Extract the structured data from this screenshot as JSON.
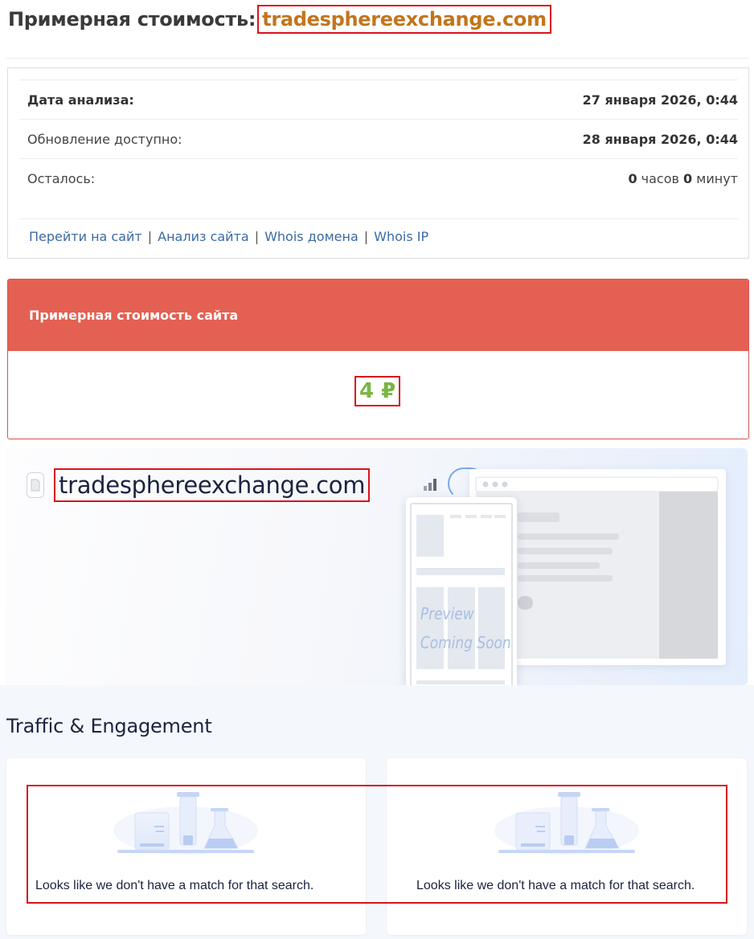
{
  "heading": {
    "prefix": "Примерная стоимость:",
    "domain": "tradesphereexchange.com"
  },
  "info": {
    "rows": [
      {
        "label": "Дата анализа:",
        "value": "27 января 2026, 0:44"
      },
      {
        "label": "Обновление доступно:",
        "value": "28 января 2026, 0:44"
      },
      {
        "label": "Осталось:",
        "hours": "0",
        "hours_unit": "часов",
        "minutes": "0",
        "minutes_unit": "минут"
      }
    ],
    "links": [
      "Перейти на сайт",
      "Анализ сайта",
      "Whois домена",
      "Whois IP"
    ],
    "separator": "|"
  },
  "price_card": {
    "title": "Примерная стоимость сайта",
    "value": "4 ₽",
    "value_color": "#79b642",
    "header_color": "#e46052"
  },
  "preview": {
    "domain": "tradesphereexchange.com",
    "placeholder_line1": "Preview",
    "placeholder_line2": "Coming Soon"
  },
  "traffic": {
    "title": "Traffic & Engagement",
    "cards": [
      {
        "message": "Looks like we don't have a match for that search."
      },
      {
        "message": "Looks like we don't have a match for that search."
      }
    ]
  },
  "colors": {
    "accent_red": "#d9131b",
    "domain_orange": "#c2751b",
    "link_blue": "#3b6aa3",
    "dark_navy": "#1b2340"
  }
}
